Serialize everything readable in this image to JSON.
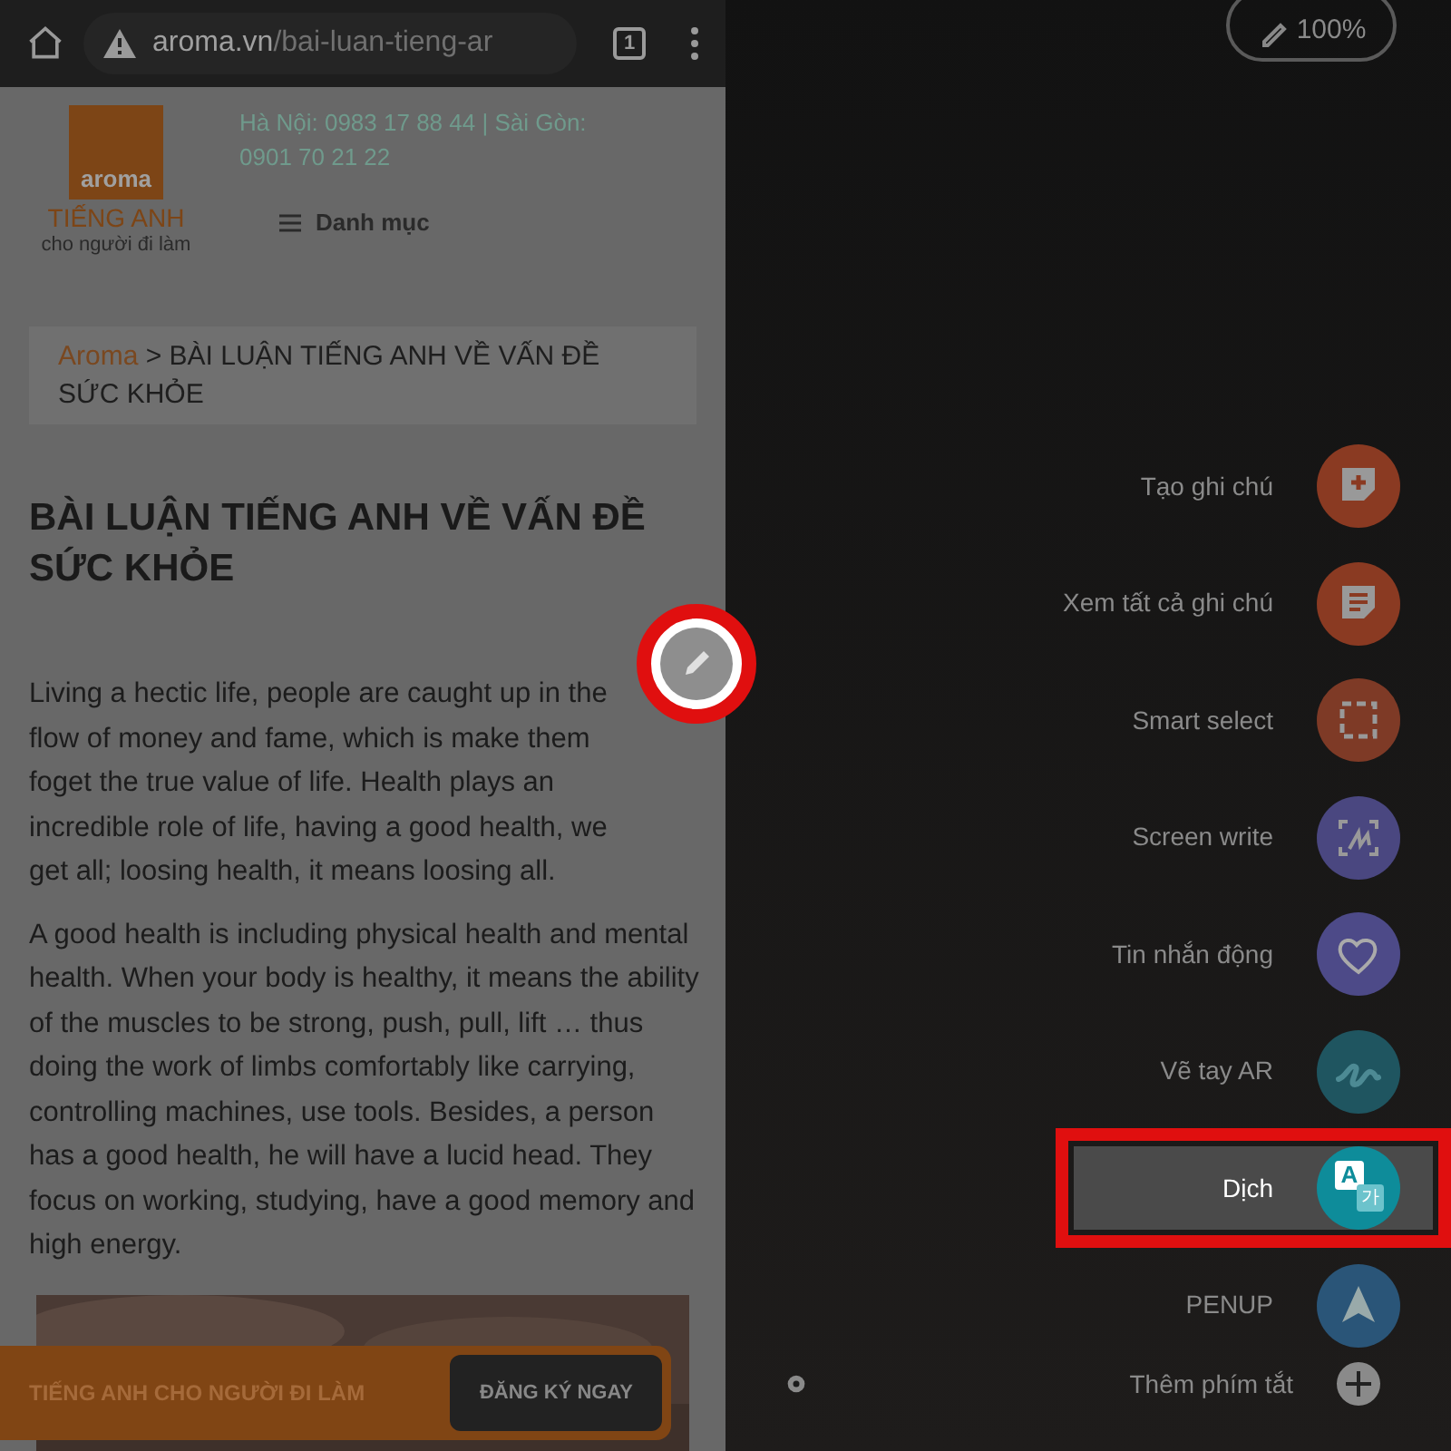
{
  "browser": {
    "url_domain": "aroma.vn",
    "url_path": "/bai-luan-tieng-ar",
    "tab_count": "1"
  },
  "site": {
    "logo_word": "aroma",
    "logo_title": "TIẾNG ANH",
    "logo_subtitle": "cho người đi làm",
    "contact": "Hà Nội: 0983 17 88 44 | Sài Gòn: 0901 70 21 22",
    "menu_label": "Danh mục"
  },
  "breadcrumb": {
    "home": "Aroma",
    "current": "> BÀI LUẬN TIẾNG ANH VỀ VẤN ĐỀ SỨC KHỎE"
  },
  "article": {
    "title": "BÀI LUẬN TIẾNG ANH VỀ VẤN ĐỀ SỨC KHỎE",
    "paragraphs": [
      "Living a hectic life, people are caught up in the flow of money and fame, which is make them foget the true value of life. Health plays an incredible role of life, having a good health, we get all; loosing health, it means loosing all.",
      "A good health is including physical health and mental health. When your body is healthy, it means the ability of the muscles to be strong, push, pull, lift … thus doing the work of limbs comfortably like carrying, controlling machines, use tools. Besides, a person has a good health, he will have a lucid head. They focus on working, studying, have a good memory and high energy."
    ]
  },
  "banner": {
    "text": "TIẾNG ANH CHO NGƯỜI ĐI LÀM",
    "button": "ĐĂNG KÝ NGAY"
  },
  "pen_status": {
    "battery": "100%"
  },
  "air_command": {
    "items": [
      {
        "label": "Tạo ghi chú",
        "kind": "note-add",
        "color": "#8a3a22",
        "selected": false
      },
      {
        "label": "Xem tất cả ghi chú",
        "kind": "notes",
        "color": "#8a3a22",
        "selected": false
      },
      {
        "label": "Smart select",
        "kind": "smart-select",
        "color": "#7e3a26",
        "selected": false
      },
      {
        "label": "Screen write",
        "kind": "screen-write",
        "color": "#4a4780",
        "selected": false
      },
      {
        "label": "Tin nhắn động",
        "kind": "heart",
        "color": "#4d4a88",
        "selected": false
      },
      {
        "label": "Vẽ tay AR",
        "kind": "ar-draw",
        "color": "#1f5560",
        "selected": false
      },
      {
        "label": "Dịch",
        "kind": "translate",
        "color": "#0e8c9a",
        "selected": true,
        "glyphs": [
          "A",
          "가"
        ]
      },
      {
        "label": "PENUP",
        "kind": "penup",
        "color": "#2a5578",
        "selected": false
      }
    ],
    "add_shortcut": "Thêm phím tắt"
  }
}
